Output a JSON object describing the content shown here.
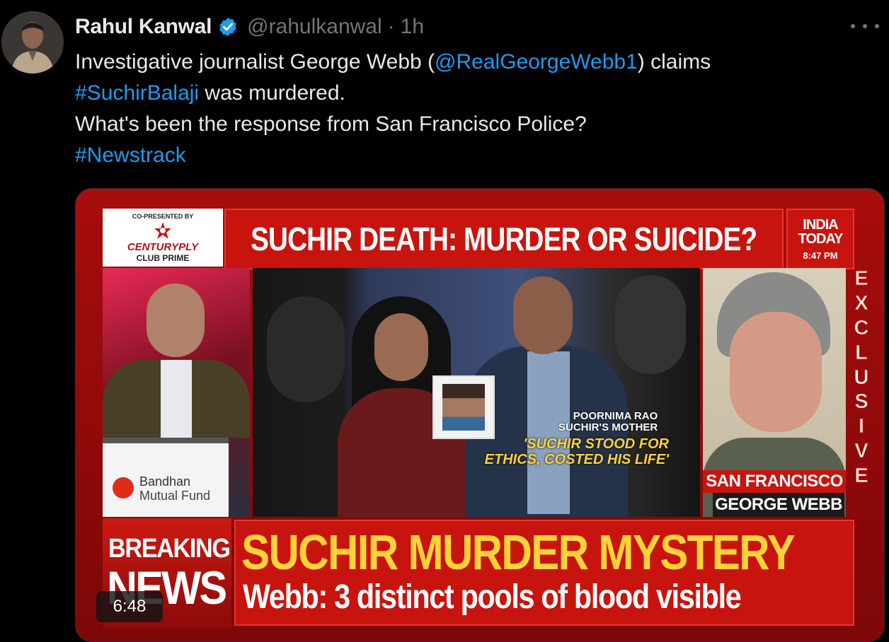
{
  "author": {
    "name": "Rahul Kanwal",
    "handle": "@rahulkanwal",
    "separator": "·",
    "time": "1h",
    "verified": true,
    "avatar_icon": "user-avatar"
  },
  "more_icon": "more-horizontal-icon",
  "tweet": {
    "line1_text1": "Investigative journalist George Webb (",
    "line1_mention": "@RealGeorgeWebb1",
    "line1_text2": ") claims",
    "line2_hashtag": "#SuchirBalaji",
    "line2_text": " was murdered.",
    "line3": "What's been the response from San Francisco Police?",
    "line4_hashtag": "#Newstrack"
  },
  "video": {
    "duration": "6:48",
    "sponsor_copresented": "CO-PRESENTED BY",
    "sponsor_brand": "CENTURYPLY",
    "sponsor_sub": "CLUB PRIME",
    "headline": "SUCHIR DEATH: MURDER OR SUICIDE?",
    "channel_name_1": "INDIA",
    "channel_name_2": "TODAY",
    "channel_time": "8:47 PM",
    "laptop_brand_1": "Bandhan",
    "laptop_brand_2": "Mutual Fund",
    "caption_name": "POORNIMA RAO",
    "caption_role": "SUCHIR'S MOTHER",
    "quote_line1": "'SUCHIR STOOD FOR",
    "quote_line2": "ETHICS, COSTED HIS LIFE'",
    "location": "SAN FRANCISCO",
    "guest_name": "GEORGE WEBB",
    "exclusive_letters": [
      "E",
      "X",
      "C",
      "L",
      "U",
      "S",
      "I",
      "V",
      "E"
    ],
    "breaking_1": "BREAKING",
    "breaking_2": "NEWS",
    "ticker_main": "SUCHIR MURDER MYSTERY",
    "ticker_sub": "Webb: 3 distinct pools of blood visible"
  },
  "colors": {
    "link": "#1d9bf0",
    "muted": "#71767b",
    "news_red": "#c8140e",
    "news_yellow": "#ffd23a"
  }
}
